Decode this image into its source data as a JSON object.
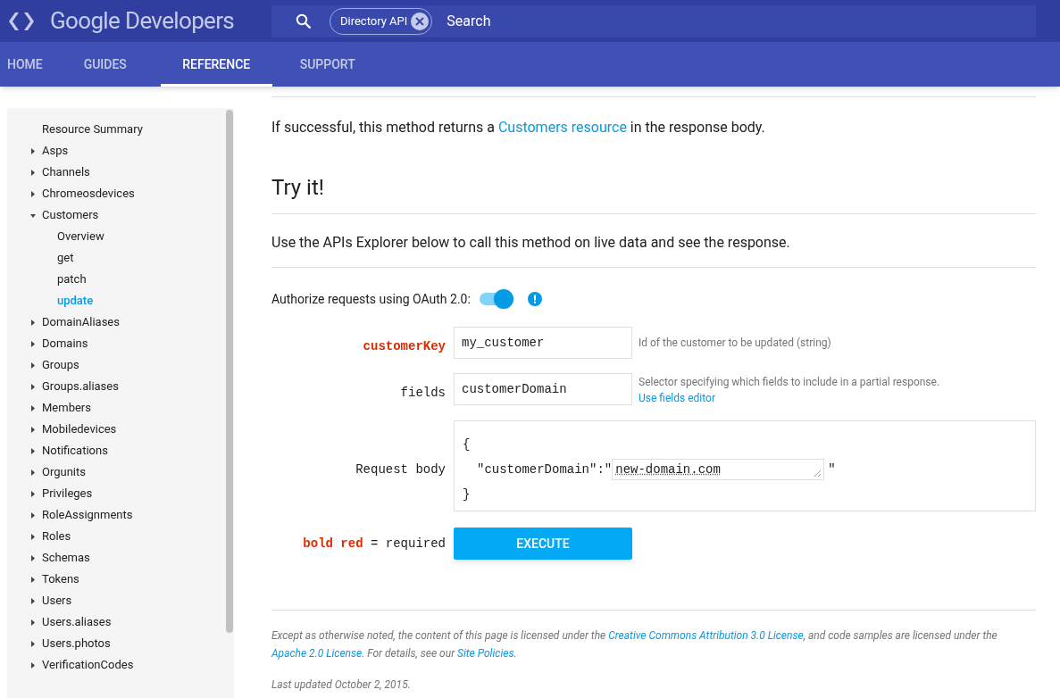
{
  "header": {
    "logo_text": "Google Developers",
    "search": {
      "chip": "Directory API",
      "placeholder": "Search"
    }
  },
  "nav_tabs": [
    {
      "label": "HOME",
      "selected": false
    },
    {
      "label": "GUIDES",
      "selected": false
    },
    {
      "label": "REFERENCE",
      "selected": true
    },
    {
      "label": "SUPPORT",
      "selected": false
    }
  ],
  "sidebar": {
    "items": [
      {
        "label": "Resource Summary",
        "kind": "page",
        "selected": false
      },
      {
        "label": "Asps",
        "kind": "group",
        "expanded": false,
        "selected": false
      },
      {
        "label": "Channels",
        "kind": "group",
        "expanded": false,
        "selected": false
      },
      {
        "label": "Chromeosdevices",
        "kind": "group",
        "expanded": false,
        "selected": false
      },
      {
        "label": "Customers",
        "kind": "group",
        "expanded": true,
        "selected": false,
        "children": [
          {
            "label": "Overview",
            "selected": false
          },
          {
            "label": "get",
            "selected": false
          },
          {
            "label": "patch",
            "selected": false
          },
          {
            "label": "update",
            "selected": true
          }
        ]
      },
      {
        "label": "DomainAliases",
        "kind": "group",
        "expanded": false,
        "selected": false
      },
      {
        "label": "Domains",
        "kind": "group",
        "expanded": false,
        "selected": false
      },
      {
        "label": "Groups",
        "kind": "group",
        "expanded": false,
        "selected": false
      },
      {
        "label": "Groups.aliases",
        "kind": "group",
        "expanded": false,
        "selected": false
      },
      {
        "label": "Members",
        "kind": "group",
        "expanded": false,
        "selected": false
      },
      {
        "label": "Mobiledevices",
        "kind": "group",
        "expanded": false,
        "selected": false
      },
      {
        "label": "Notifications",
        "kind": "group",
        "expanded": false,
        "selected": false
      },
      {
        "label": "Orgunits",
        "kind": "group",
        "expanded": false,
        "selected": false
      },
      {
        "label": "Privileges",
        "kind": "group",
        "expanded": false,
        "selected": false
      },
      {
        "label": "RoleAssignments",
        "kind": "group",
        "expanded": false,
        "selected": false
      },
      {
        "label": "Roles",
        "kind": "group",
        "expanded": false,
        "selected": false
      },
      {
        "label": "Schemas",
        "kind": "group",
        "expanded": false,
        "selected": false
      },
      {
        "label": "Tokens",
        "kind": "group",
        "expanded": false,
        "selected": false
      },
      {
        "label": "Users",
        "kind": "group",
        "expanded": false,
        "selected": false
      },
      {
        "label": "Users.aliases",
        "kind": "group",
        "expanded": false,
        "selected": false
      },
      {
        "label": "Users.photos",
        "kind": "group",
        "expanded": false,
        "selected": false
      },
      {
        "label": "VerificationCodes",
        "kind": "group",
        "expanded": false,
        "selected": false
      }
    ]
  },
  "response": {
    "before": "If successful, this method returns a",
    "link": "Customers resource",
    "after": "in the response body."
  },
  "try_it": {
    "heading": "Try it!",
    "intro": "Use the APIs Explorer below to call this method on live data and see the response.",
    "authorize": {
      "label": "Authorize requests using OAuth 2.0:",
      "on": true
    },
    "params": [
      {
        "kind": "field",
        "name": "customerKey",
        "required": true,
        "value": "my_customer",
        "help": "Id of the customer to be updated (string)"
      },
      {
        "kind": "field",
        "name": "fields",
        "required": false,
        "value": "customerDomain",
        "help": "Selector specifying which fields to include in a partial response.",
        "help_link": "Use fields editor"
      },
      {
        "kind": "body",
        "name": "Request body",
        "required": false,
        "open": "{",
        "key": "\"customerDomain\":\"",
        "value": "new-domain.com",
        "quote": "\"",
        "close": "}"
      }
    ],
    "legend": {
      "marker": "bold red",
      "text": "= required"
    },
    "execute": "EXECUTE"
  },
  "footer": {
    "license_parts": [
      {
        "kind": "text",
        "text": "Except as otherwise noted, the content of this page is licensed under the"
      },
      {
        "kind": "link",
        "text": "Creative Commons Attribution 3.0 License"
      },
      {
        "kind": "text",
        "text": ", and code samples are licensed under the"
      },
      {
        "kind": "link",
        "text": "Apache 2.0 License"
      },
      {
        "kind": "text",
        "text": ". For details, see our"
      },
      {
        "kind": "link",
        "text": "Site Policies"
      },
      {
        "kind": "text",
        "text": "."
      }
    ],
    "updated": "Last updated October 2, 2015."
  }
}
